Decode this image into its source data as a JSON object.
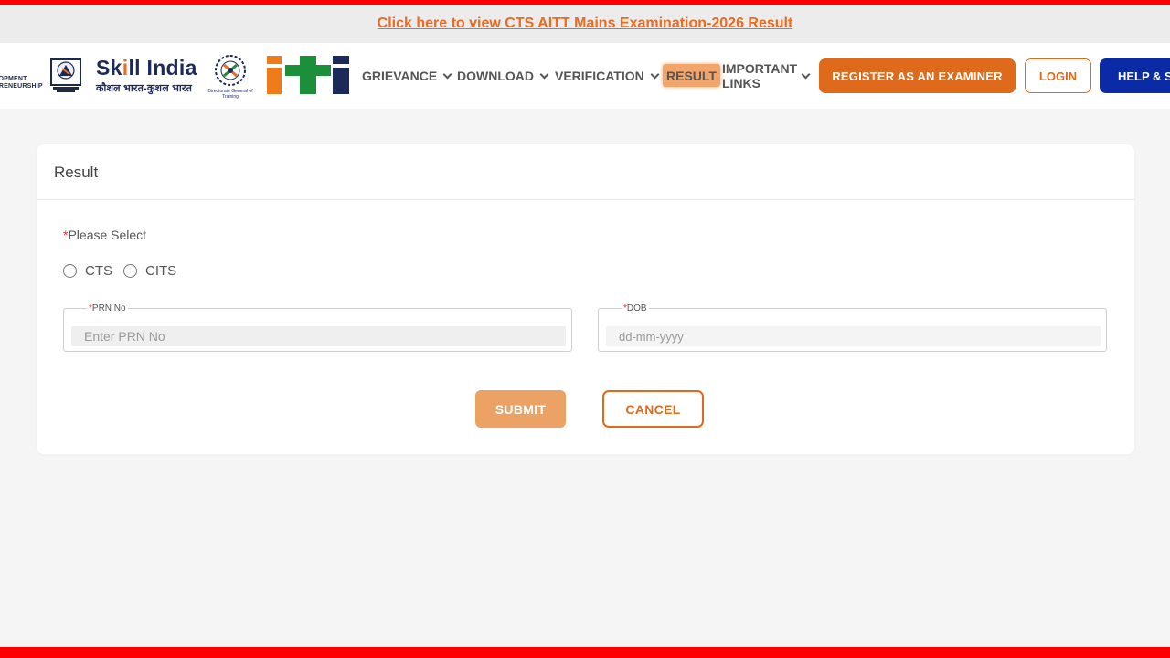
{
  "announcement": {
    "link_text": "Click here to view CTS AITT Mains Examination-2026 Result"
  },
  "logos": {
    "msde_line1": "LOPMENT",
    "msde_line2": "PRENEURSHIP",
    "skill_india_title_part1": "Sk",
    "skill_india_title_part2": "ll India",
    "skill_india_subtitle": "कौशल भारत-कुशल भारत",
    "dgt_caption": "Directorate General of Training"
  },
  "nav": {
    "grievance": "GRIEVANCE",
    "download": "DOWNLOAD",
    "verification": "VERIFICATION",
    "result": "RESULT",
    "important_links": "IMPORTANT LINKS"
  },
  "header_buttons": {
    "register": "REGISTER AS AN EXAMINER",
    "login": "LOGIN",
    "help": "HELP & SU"
  },
  "card": {
    "title": "Result",
    "select_required_mark": "*",
    "select_label": "Please Select",
    "radio_options": [
      "CTS",
      "CITS"
    ],
    "prn": {
      "required_mark": "*",
      "label": "PRN No",
      "placeholder": "Enter PRN No"
    },
    "dob": {
      "required_mark": "*",
      "label": "DOB",
      "placeholder": "dd-mm-yyyy"
    },
    "submit_label": "SUBMIT",
    "cancel_label": "CANCEL"
  },
  "colors": {
    "accent_orange": "#e06a1b",
    "announcement_orange": "#ef6a1e",
    "help_blue": "#0a2aa6",
    "border_red": "#ff0000",
    "result_highlight": "#f2a56b"
  }
}
